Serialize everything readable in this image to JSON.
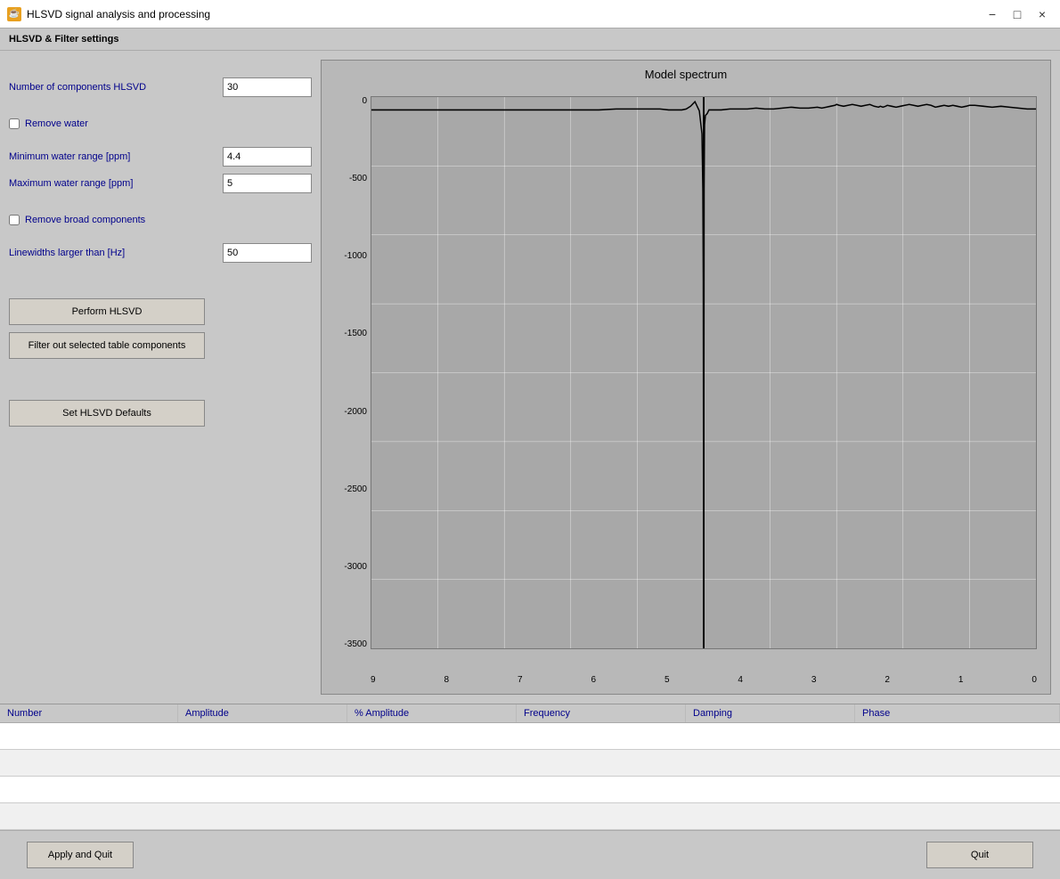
{
  "titleBar": {
    "title": "HLSVD signal analysis and processing",
    "icon": "☕",
    "controls": [
      "−",
      "□",
      "×"
    ]
  },
  "sectionHeader": "HLSVD & Filter settings",
  "leftPanel": {
    "numComponentsLabel": "Number of components HLSVD",
    "numComponentsValue": "30",
    "removeWaterLabel": "Remove water",
    "minWaterLabel": "Minimum water range [ppm]",
    "minWaterValue": "4.4",
    "maxWaterLabel": "Maximum water range [ppm]",
    "maxWaterValue": "5",
    "removeBroadLabel": "Remove broad components",
    "linewidthsLabel": "Linewidths larger than [Hz]",
    "linewidthsValue": "50",
    "performButton": "Perform HLSVD",
    "filterButton": "Filter out selected table components",
    "defaultsButton": "Set HLSVD Defaults"
  },
  "chart": {
    "title": "Model spectrum",
    "yLabels": [
      "0",
      "-500",
      "-1000",
      "-1500",
      "-2000",
      "-2500",
      "-3000",
      "-3500"
    ],
    "xLabels": [
      "9",
      "8",
      "7",
      "6",
      "5",
      "4",
      "3",
      "2",
      "1",
      "0"
    ]
  },
  "table": {
    "columns": [
      "Number",
      "Amplitude",
      "% Amplitude",
      "Frequency",
      "Damping",
      "Phase"
    ],
    "rows": []
  },
  "footer": {
    "applyQuitLabel": "Apply and Quit",
    "quitLabel": "Quit"
  }
}
